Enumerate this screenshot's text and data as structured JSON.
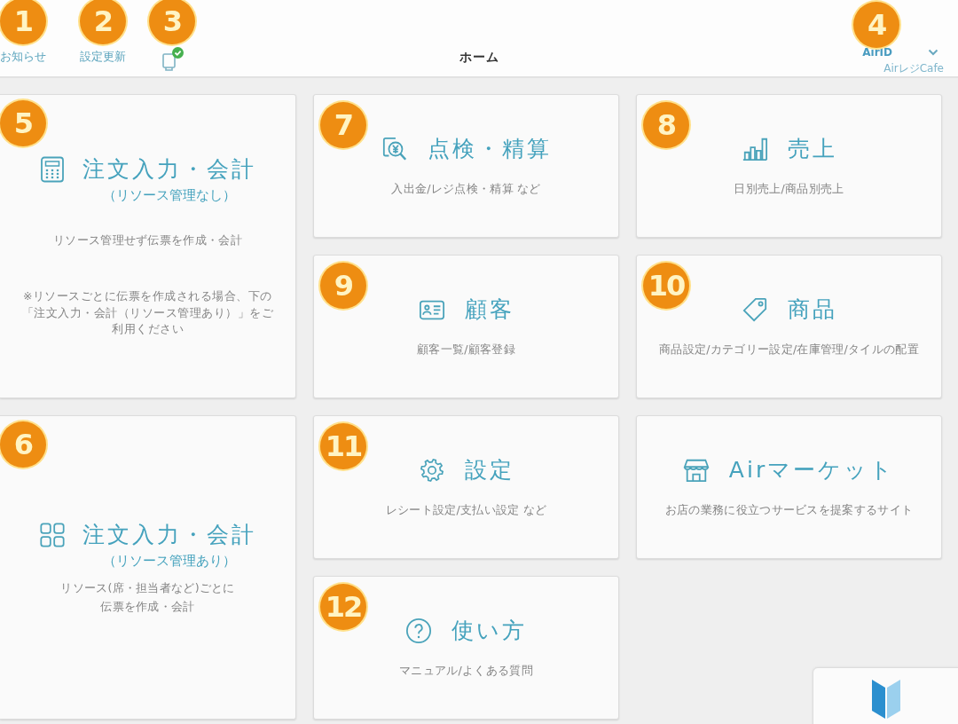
{
  "header": {
    "actions": [
      {
        "kind": "text",
        "label": "お知らせ",
        "callout": "1"
      },
      {
        "kind": "text",
        "label": "設定更新",
        "callout": "2"
      },
      {
        "kind": "icon",
        "callout": "3"
      }
    ],
    "title": "ホーム",
    "account": {
      "label": "AirID",
      "store": "AirレジCafe",
      "callout": "4"
    }
  },
  "side_tiles": [
    {
      "title": "注文入力・会計",
      "subtitle": "（リソース管理なし）",
      "description_lines": [
        "リソース管理せず伝票を作成・会計"
      ],
      "note": "※リソースごとに伝票を作成される場合、下の「注文入力・会計（リソース管理あり）」をご利用ください",
      "callout": "5"
    },
    {
      "title": "注文入力・会計",
      "subtitle": "（リソース管理あり）",
      "description_lines": [
        "リソース(席・担当者など)ごとに",
        "伝票を作成・会計"
      ],
      "callout": "6"
    }
  ],
  "tiles": [
    {
      "title": "点検・精算",
      "description": "入出金/レジ点検・精算 など",
      "callout": "7"
    },
    {
      "title": "売上",
      "description": "日別売上/商品別売上",
      "callout": "8"
    },
    {
      "title": "顧客",
      "description": "顧客一覧/顧客登録",
      "callout": "9"
    },
    {
      "title": "商品",
      "description": "商品設定/カテゴリー設定/在庫管理/タイルの配置",
      "callout": "10"
    },
    {
      "title": "設定",
      "description": "レシート設定/支払い設定 など",
      "callout": "11"
    },
    {
      "title": "Airマーケット",
      "description": "お店の業務に役立つサービスを提案するサイト"
    },
    {
      "title": "使い方",
      "description": "マニュアル/よくある質問",
      "callout": "12"
    }
  ]
}
